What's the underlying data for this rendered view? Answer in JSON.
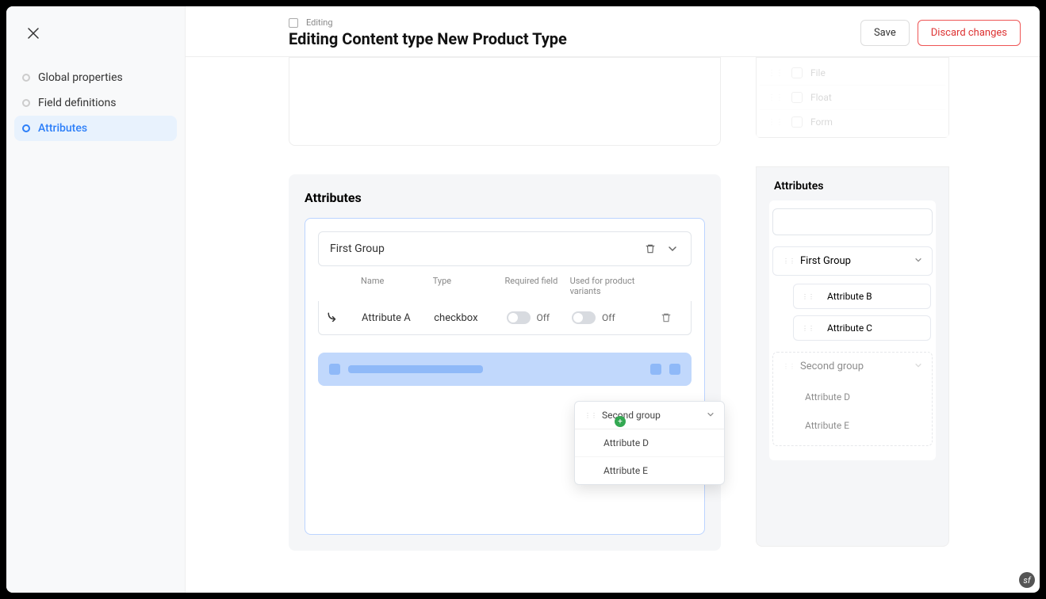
{
  "header": {
    "crumb": "Editing",
    "title": "Editing Content type New Product Type",
    "save": "Save",
    "discard": "Discard changes"
  },
  "sidebar": {
    "items": [
      {
        "label": "Global properties",
        "active": false
      },
      {
        "label": "Field definitions",
        "active": false
      },
      {
        "label": "Attributes",
        "active": true
      }
    ]
  },
  "field_types_panel": {
    "items": [
      "File",
      "Float",
      "Form"
    ]
  },
  "attributes_panel": {
    "title": "Attributes",
    "group": {
      "name": "First Group",
      "columns": {
        "name": "Name",
        "type": "Type",
        "required": "Required field",
        "variants": "Used for product variants"
      },
      "rows": [
        {
          "name": "Attribute A",
          "type": "checkbox",
          "required": "Off",
          "variants": "Off"
        }
      ]
    }
  },
  "dragged_group": {
    "name": "Second group",
    "items": [
      "Attribute D",
      "Attribute E"
    ]
  },
  "palette": {
    "title": "Attributes",
    "groups": [
      {
        "name": "First Group",
        "dragging": false,
        "items": [
          "Attribute B",
          "Attribute C"
        ]
      },
      {
        "name": "Second group",
        "dragging": true,
        "items": [
          "Attribute D",
          "Attribute E"
        ]
      }
    ]
  }
}
